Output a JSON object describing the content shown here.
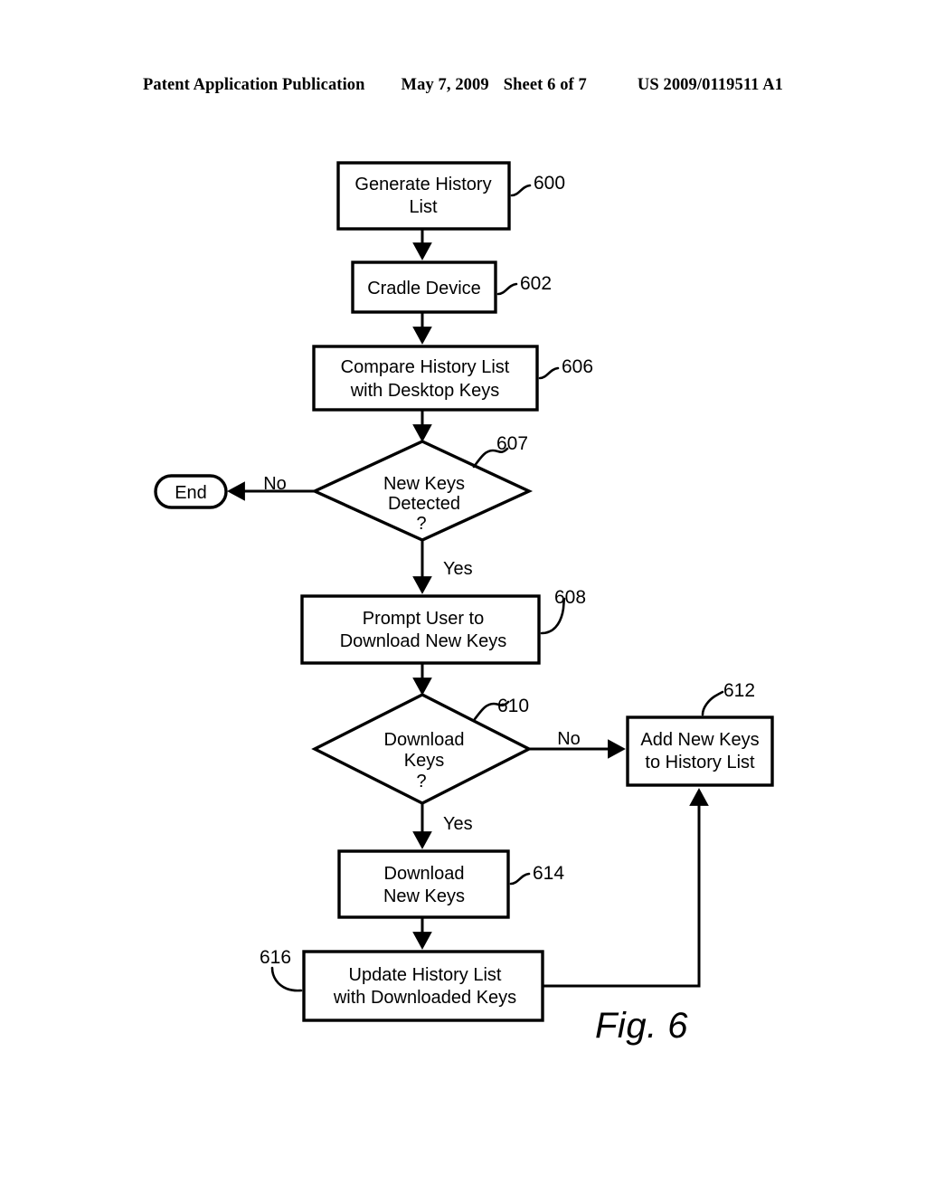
{
  "header": {
    "publication": "Patent Application Publication",
    "date": "May 7, 2009",
    "sheet": "Sheet 6 of 7",
    "patent_number": "US 2009/0119511 A1"
  },
  "figure": {
    "caption": "Fig. 6"
  },
  "nodes": {
    "n600": {
      "line1": "Generate History",
      "line2": "List",
      "ref": "600"
    },
    "n602": {
      "line1": "Cradle Device",
      "line2": "",
      "ref": "602"
    },
    "n606": {
      "line1": "Compare History List",
      "line2": "with Desktop Keys",
      "ref": "606"
    },
    "n607": {
      "line1": "New Keys",
      "line2": "Detected",
      "line3": "?",
      "ref": "607"
    },
    "n608": {
      "line1": "Prompt User to",
      "line2": "Download New Keys",
      "ref": "608"
    },
    "n610": {
      "line1": "Download",
      "line2": "Keys",
      "line3": "?",
      "ref": "610"
    },
    "n612": {
      "line1": "Add New Keys",
      "line2": "to History List",
      "ref": "612"
    },
    "n614": {
      "line1": "Download",
      "line2": "New Keys",
      "ref": "614"
    },
    "n616": {
      "line1": "Update History List",
      "line2": "with Downloaded Keys",
      "ref": "616"
    },
    "end": {
      "label": "End"
    }
  },
  "edge_labels": {
    "no_end": "No",
    "yes_prompt": "Yes",
    "no_add": "No",
    "yes_download": "Yes"
  },
  "colors": {
    "ink": "#000000",
    "paper": "#ffffff"
  }
}
